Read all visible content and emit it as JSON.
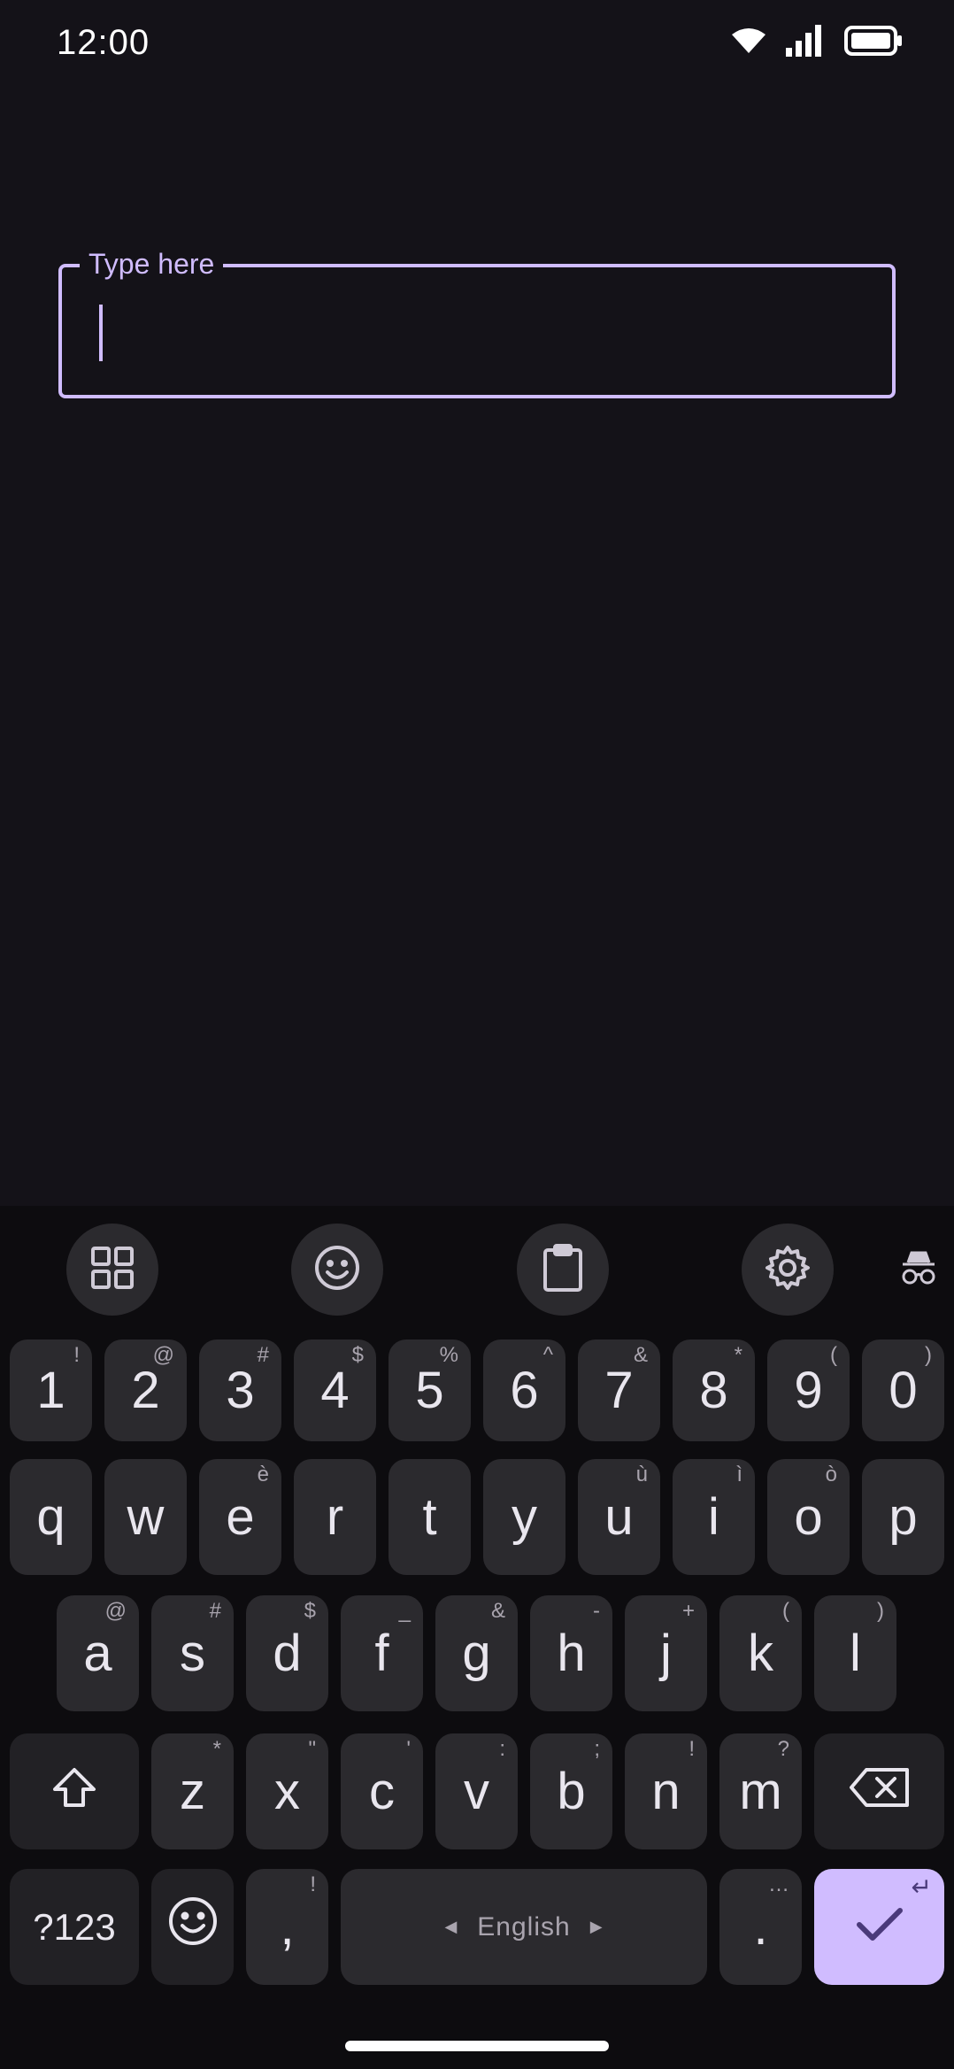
{
  "status_bar": {
    "time": "12:00",
    "icons": [
      "wifi-icon",
      "cellular-signal-icon",
      "battery-icon"
    ]
  },
  "text_field": {
    "label": "Type here",
    "value": ""
  },
  "keyboard": {
    "toolbar": {
      "buttons": [
        "apps-grid-icon",
        "emoji-icon",
        "clipboard-icon",
        "settings-icon"
      ],
      "right_icon": "incognito-icon"
    },
    "number_row": [
      {
        "key": "1",
        "hint": "!"
      },
      {
        "key": "2",
        "hint": "@"
      },
      {
        "key": "3",
        "hint": "#"
      },
      {
        "key": "4",
        "hint": "$"
      },
      {
        "key": "5",
        "hint": "%"
      },
      {
        "key": "6",
        "hint": "^"
      },
      {
        "key": "7",
        "hint": "&"
      },
      {
        "key": "8",
        "hint": "*"
      },
      {
        "key": "9",
        "hint": "("
      },
      {
        "key": "0",
        "hint": ")"
      }
    ],
    "row1": [
      {
        "key": "q",
        "hint": ""
      },
      {
        "key": "w",
        "hint": ""
      },
      {
        "key": "e",
        "hint": "è"
      },
      {
        "key": "r",
        "hint": ""
      },
      {
        "key": "t",
        "hint": ""
      },
      {
        "key": "y",
        "hint": ""
      },
      {
        "key": "u",
        "hint": "ù"
      },
      {
        "key": "i",
        "hint": "ì"
      },
      {
        "key": "o",
        "hint": "ò"
      },
      {
        "key": "p",
        "hint": ""
      }
    ],
    "row2": [
      {
        "key": "a",
        "hint": "@"
      },
      {
        "key": "s",
        "hint": "#"
      },
      {
        "key": "d",
        "hint": "$"
      },
      {
        "key": "f",
        "hint": "_"
      },
      {
        "key": "g",
        "hint": "&"
      },
      {
        "key": "h",
        "hint": "-"
      },
      {
        "key": "j",
        "hint": "+"
      },
      {
        "key": "k",
        "hint": "("
      },
      {
        "key": "l",
        "hint": ")"
      }
    ],
    "row3": [
      {
        "key": "z",
        "hint": "*"
      },
      {
        "key": "x",
        "hint": "\""
      },
      {
        "key": "c",
        "hint": "'"
      },
      {
        "key": "v",
        "hint": ":"
      },
      {
        "key": "b",
        "hint": ";"
      },
      {
        "key": "n",
        "hint": "!"
      },
      {
        "key": "m",
        "hint": "?"
      }
    ],
    "bottom_row": {
      "symbols_label": "?123",
      "comma": ",",
      "comma_hint": "!",
      "space_label": "English",
      "period": ".",
      "period_hint": "…",
      "enter_hint": "↵"
    },
    "colors": {
      "accent": "#d0bcff",
      "key": "#2b2a2e",
      "background": "#0d0c0f",
      "enter_icon": "#4a3a7a"
    }
  }
}
